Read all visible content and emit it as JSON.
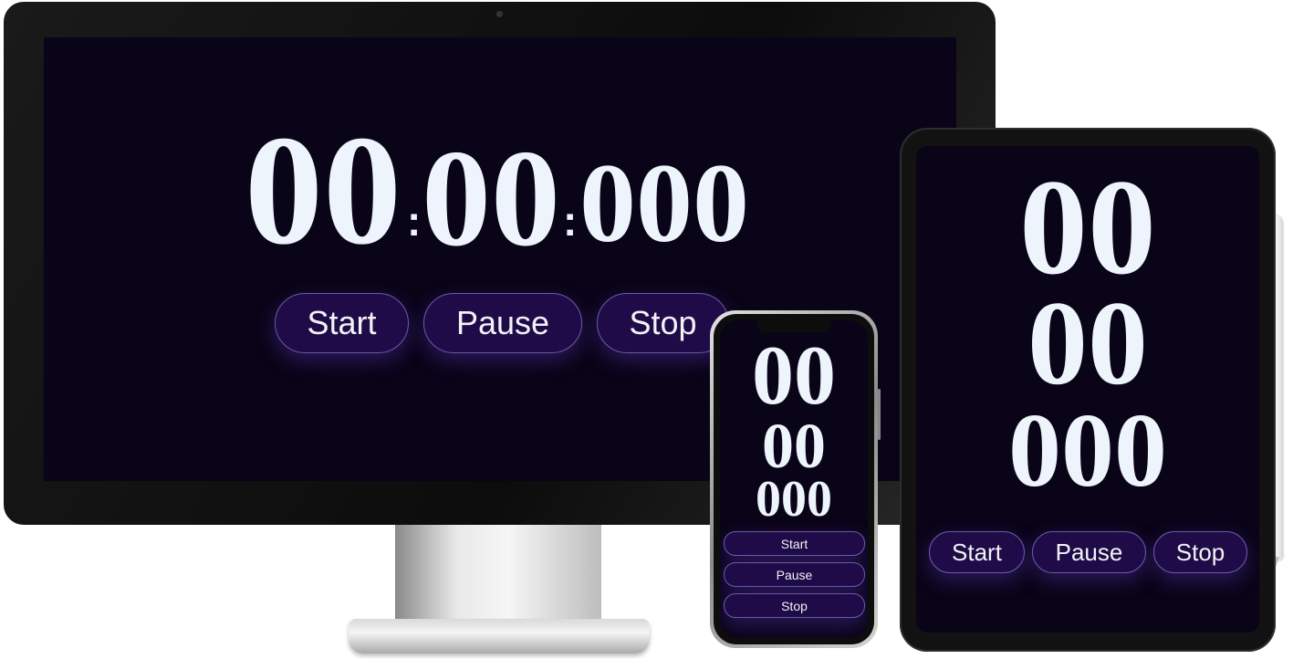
{
  "colors": {
    "screen_background": "#0a0418",
    "digit_color": "#eef4fb",
    "button_fill": "#1e0b47",
    "button_border": "#6e5aa8",
    "button_glow": "#5a37be",
    "device_frame": "#111111"
  },
  "timer": {
    "hours": "00",
    "minutes": "00",
    "milliseconds": "000",
    "separator": ":"
  },
  "controls": {
    "start": "Start",
    "pause": "Pause",
    "stop": "Stop"
  }
}
